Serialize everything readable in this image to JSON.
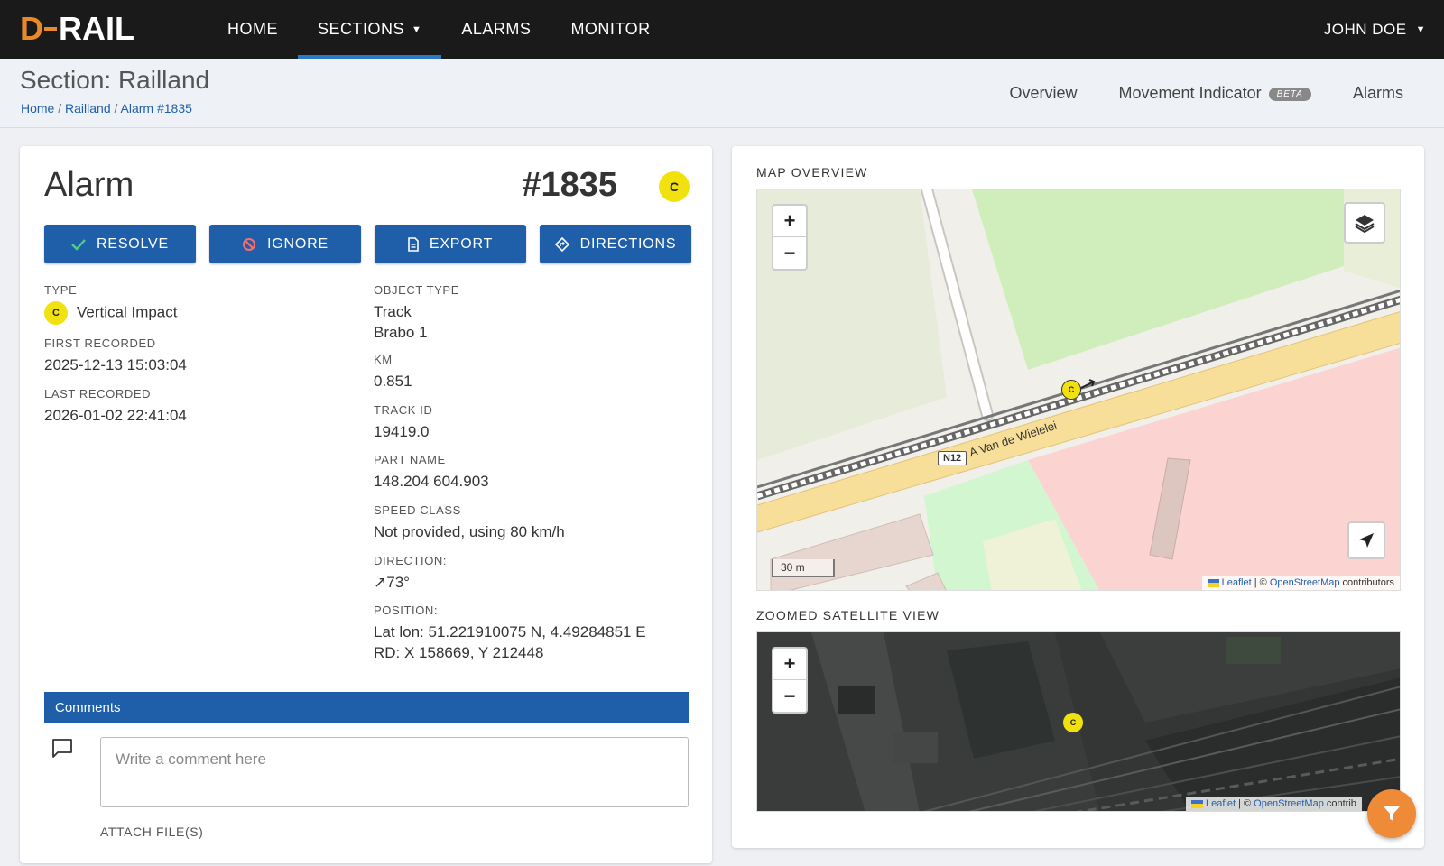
{
  "brand": {
    "logo_d": "D",
    "logo_rail": "RAIL",
    "accent": "#e8892a"
  },
  "nav": {
    "items": [
      {
        "label": "HOME"
      },
      {
        "label": "SECTIONS"
      },
      {
        "label": "ALARMS"
      },
      {
        "label": "MONITOR"
      }
    ],
    "user": "JOHN DOE"
  },
  "section": {
    "title": "Section: Railland",
    "breadcrumb": [
      "Home",
      "Railland",
      "Alarm #1835"
    ],
    "tabs": [
      {
        "label": "Overview"
      },
      {
        "label": "Movement Indicator",
        "badge": "BETA"
      },
      {
        "label": "Alarms"
      }
    ]
  },
  "alarm": {
    "title": "Alarm",
    "id": "#1835",
    "severity": "C",
    "actions": {
      "resolve": "RESOLVE",
      "ignore": "IGNORE",
      "export": "EXPORT",
      "directions": "DIRECTIONS"
    },
    "fields": {
      "type_label": "TYPE",
      "type_value": "Vertical Impact",
      "first_recorded_label": "FIRST RECORDED",
      "first_recorded_value": "2025-12-13 15:03:04",
      "last_recorded_label": "LAST RECORDED",
      "last_recorded_value": "2026-01-02 22:41:04",
      "object_type_label": "OBJECT TYPE",
      "object_type_value1": "Track",
      "object_type_value2": "Brabo 1",
      "km_label": "KM",
      "km_value": "0.851",
      "track_id_label": "TRACK ID",
      "track_id_value": "19419.0",
      "part_name_label": "PART NAME",
      "part_name_value": "148.204 604.903",
      "speed_class_label": "SPEED CLASS",
      "speed_class_value": "Not provided, using 80 km/h",
      "direction_label": "DIRECTION:",
      "direction_value": "↗73°",
      "position_label": "POSITION:",
      "position_latlon": "Lat lon: 51.221910075 N, 4.49284851 E",
      "position_rd": "RD: X 158669, Y 212448"
    },
    "comments": {
      "header": "Comments",
      "placeholder": "Write a comment here",
      "attach": "ATTACH FILE(S)"
    }
  },
  "map": {
    "overview_label": "MAP OVERVIEW",
    "satellite_label": "ZOOMED SATELLITE VIEW",
    "zoom_in": "+",
    "zoom_out": "−",
    "scale": "30 m",
    "road_label": "N12",
    "road_name": "A   Van de Wielelei",
    "marker": "C",
    "attribution_leaflet": "Leaflet",
    "attribution_sep": " | © ",
    "attribution_osm": "OpenStreetMap",
    "attribution_tail": " contributors",
    "attribution_tail_short": " contrib"
  },
  "colors": {
    "primary": "#1f5fa9",
    "severity_c": "#f1e20f",
    "fab": "#ef8a36"
  }
}
